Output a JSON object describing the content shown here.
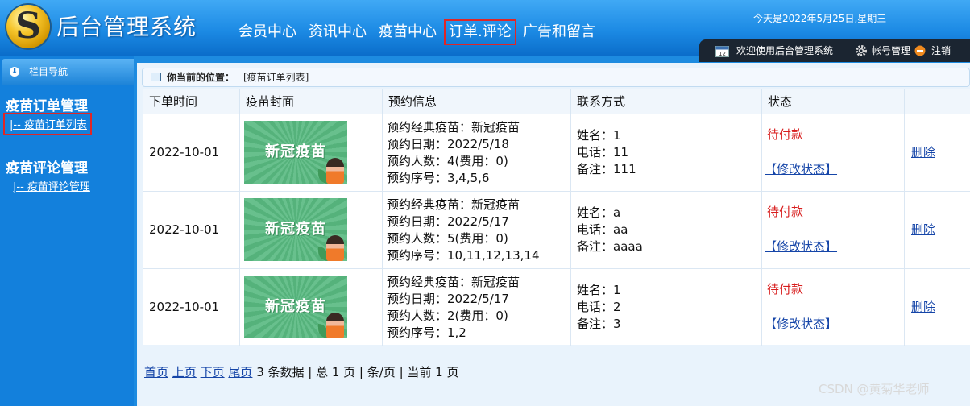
{
  "header": {
    "title": "后台管理系统",
    "nav": [
      "会员中心",
      "资讯中心",
      "疫苗中心",
      "订单.评论",
      "广告和留言"
    ],
    "date": "今天是2022年5月25日,星期三",
    "welcome": "欢迎使用后台管理系统",
    "account": "帐号管理",
    "logout": "注销"
  },
  "sidebar": {
    "head": "栏目导航",
    "groups": [
      {
        "title": "疫苗订单管理",
        "link": "|-- 疫苗订单列表"
      },
      {
        "title": "疫苗评论管理",
        "link": "|-- 疫苗评论管理"
      }
    ]
  },
  "main": {
    "crumb_label": "你当前的位置：",
    "crumb_value": "[疫苗订单列表]",
    "columns": [
      "下单时间",
      "疫苗封面",
      "预约信息",
      "联系方式",
      "状态"
    ],
    "image_caption": "新冠疫苗",
    "rows": [
      {
        "date": "2022-10-01",
        "info": [
          "预约经典疫苗：新冠疫苗",
          "预约日期：2022/5/18",
          "预约人数：4(费用：0)",
          "预约序号：3,4,5,6"
        ],
        "contact": [
          "姓名：1",
          "电话：11",
          "备注：111"
        ],
        "status": "待付款",
        "modify": "【修改状态】",
        "delete": "删除"
      },
      {
        "date": "2022-10-01",
        "info": [
          "预约经典疫苗：新冠疫苗",
          "预约日期：2022/5/17",
          "预约人数：5(费用：0)",
          "预约序号：10,11,12,13,14"
        ],
        "contact": [
          "姓名：a",
          "电话：aa",
          "备注：aaaa"
        ],
        "status": "待付款",
        "modify": "【修改状态】",
        "delete": "删除"
      },
      {
        "date": "2022-10-01",
        "info": [
          "预约经典疫苗：新冠疫苗",
          "预约日期：2022/5/17",
          "预约人数：2(费用：0)",
          "预约序号：1,2"
        ],
        "contact": [
          "姓名：1",
          "电话：2",
          "备注：3"
        ],
        "status": "待付款",
        "modify": "【修改状态】",
        "delete": "删除"
      }
    ],
    "pager": {
      "first": "首页",
      "prev": "上页",
      "next": "下页",
      "last": "尾页",
      "summary": "3 条数据 | 总 1 页 | 条/页 | 当前 1 页"
    }
  },
  "watermark": "CSDN @黄菊华老师",
  "colors": {
    "highlight_box": "#e02626",
    "status": "#d81e1e",
    "link": "#1545a8"
  }
}
